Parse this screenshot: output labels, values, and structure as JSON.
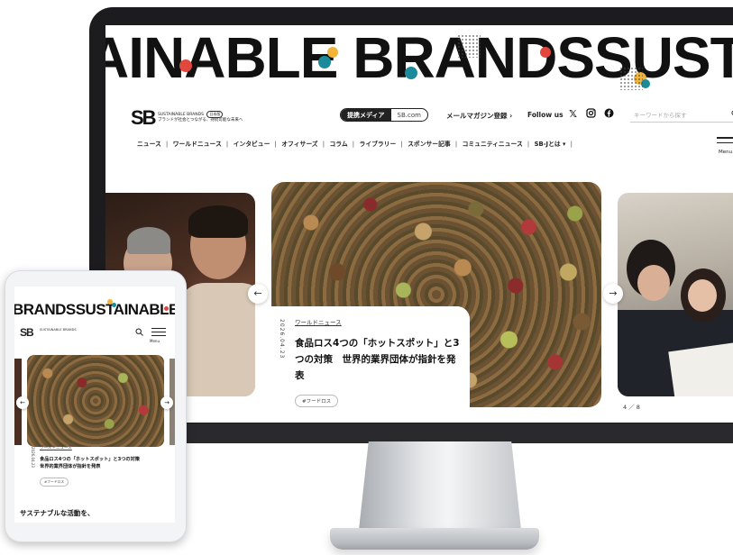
{
  "desktop": {
    "hero_banner": "AINABLE BRANDSSUST",
    "logo": {
      "mark": "SB",
      "name": "SUSTAINABLE BRANDS",
      "edition": "日本版",
      "tagline": "ブランドが社会とつながる、持続可能な未来へ"
    },
    "media_pill": {
      "label": "提携メディア",
      "link": "SB.com"
    },
    "newsletter_link": "メールマガジン登録 ›",
    "follow_label": "Follow us",
    "social": [
      "x-icon",
      "instagram-icon",
      "facebook-icon"
    ],
    "search": {
      "placeholder": "キーワードから探す",
      "icon": "search-icon"
    },
    "nav": [
      "ニュース",
      "ワールドニュース",
      "インタビュー",
      "オフィサーズ",
      "コラム",
      "ライブラリー",
      "スポンサー記事",
      "コミュニティニュース",
      "SB-Jとは ▾"
    ],
    "menu_label": "Menu",
    "article": {
      "date": "2026.04.23",
      "category": "ワールドニュース",
      "title": "食品ロス4つの「ホットスポット」と3つの対策　世界的業界団体が指針を発表",
      "tag": "#フードロス"
    },
    "slide_counter": "4 ／ 8"
  },
  "tablet": {
    "hero_banner": "BRANDSSUSTAINABLE B",
    "logo": {
      "mark": "SB",
      "name": "SUSTAINABLE BRANDS"
    },
    "menu_label": "Menu",
    "article": {
      "date": "2026.04.23",
      "category": "ワールドニュース",
      "title": "食品ロス4つの「ホットスポット」と3つの対策　世界的業界団体が指針を発表",
      "tag": "#フードロス"
    },
    "bottom_text": "サステナブルな活動を、"
  },
  "colors": {
    "accent_red": "#e2473d",
    "accent_teal": "#1b8a9a",
    "accent_yellow": "#f2b33a",
    "dark": "#111111"
  }
}
